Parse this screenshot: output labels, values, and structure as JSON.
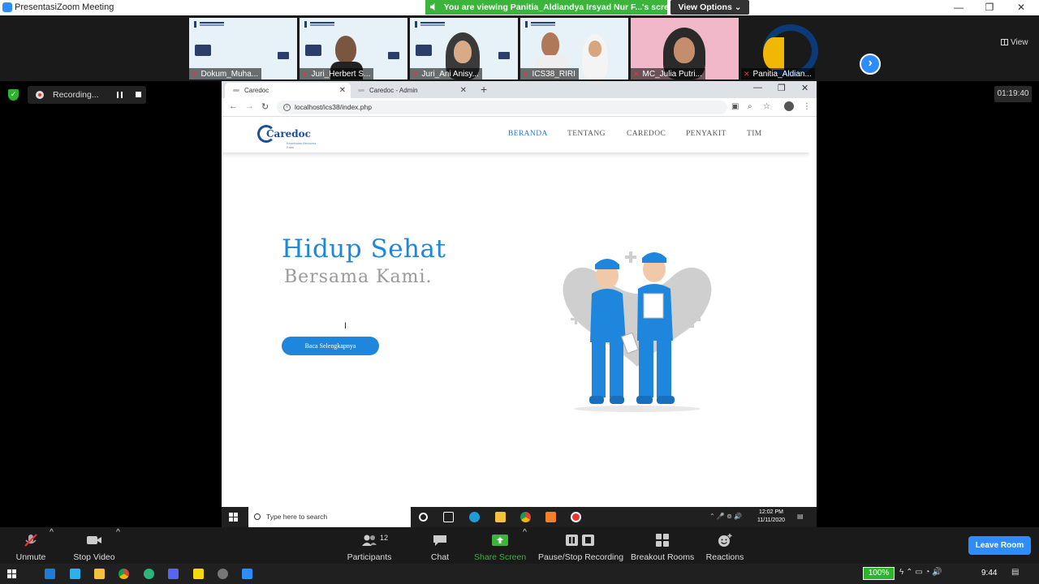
{
  "window": {
    "app_name": "Presentasi",
    "title": "Zoom Meeting",
    "minimize_glyph": "—",
    "maximize_glyph": "❐",
    "close_glyph": "✕"
  },
  "banner": {
    "viewing_text": "You are viewing Panitia_Aldiandya Irsyad Nur F...'s screen",
    "view_options_label": "View Options ⌄"
  },
  "gallery": {
    "participants": [
      {
        "name": "Dokum_Muha..."
      },
      {
        "name": "Juri_Herbert S..."
      },
      {
        "name": "Juri_Ani Anisy..."
      },
      {
        "name": "ICS38_RIRI"
      },
      {
        "name": "MC_Julia Putri..."
      },
      {
        "name": "Panitia_Aldian..."
      }
    ],
    "next_glyph": "›",
    "view_label": "View"
  },
  "recording": {
    "label": "Recording...",
    "elapsed": "01:19:40"
  },
  "browser": {
    "tabs": [
      {
        "label": "Caredoc",
        "active": true
      },
      {
        "label": "Caredoc - Admin",
        "active": false
      }
    ],
    "new_tab_glyph": "+",
    "url": "localhost/ics38/index.php",
    "back_glyph": "←",
    "forward_glyph": "→",
    "reload_glyph": "↻",
    "info_glyph": "i",
    "zoom_glyph": "⌕",
    "star_glyph": "☆",
    "menu_glyph": "⋮",
    "minimize_glyph": "—",
    "restore_glyph": "❐",
    "close_glyph": "✕"
  },
  "site": {
    "brand_word": "Caredoc",
    "brand_tagline": "Kesehatan Bersama Kami",
    "nav": [
      {
        "label": "BERANDA",
        "active": true
      },
      {
        "label": "TENTANG",
        "active": false
      },
      {
        "label": "CAREDOC",
        "active": false
      },
      {
        "label": "PENYAKIT",
        "active": false
      },
      {
        "label": "TIM",
        "active": false
      }
    ],
    "hero_title": "Hidup Sehat",
    "hero_subtitle": "Bersama Kami.",
    "cta_label": "Baca Selengkapnya",
    "primary_color": "#1e86dc"
  },
  "shared_taskbar": {
    "search_placeholder": "Type here to search",
    "time": "12:02 PM",
    "date": "11/11/2020",
    "tray_glyphs": "⌃ 🎤 ⊚ 🔊"
  },
  "controls": {
    "unmute": "Unmute",
    "stop_video": "Stop Video",
    "participants": "Participants",
    "participants_count": "12",
    "chat": "Chat",
    "share_screen": "Share Screen",
    "pause_stop_recording": "Pause/Stop Recording",
    "breakout_rooms": "Breakout Rooms",
    "reactions": "Reactions",
    "leave_room": "Leave Room",
    "caret_glyph": "^",
    "share_color": "#3cb43c"
  },
  "host_taskbar": {
    "battery": "100%",
    "time": "9:44",
    "tray_glyphs": "ϟ ⌃ ▭ ◔ 🔊",
    "notification_glyph": "▤"
  }
}
